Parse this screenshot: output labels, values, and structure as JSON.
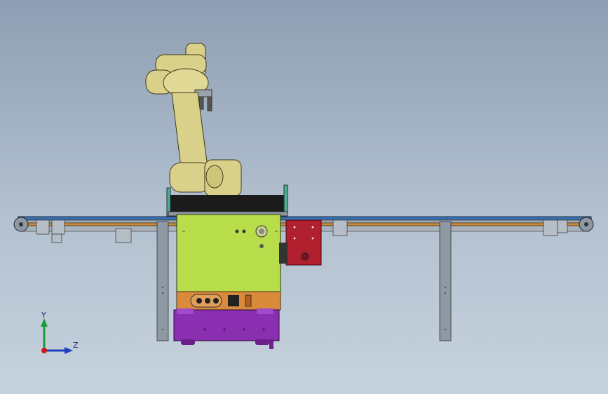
{
  "viewport": {
    "background_top": "#8d9fb3",
    "background_bottom": "#c6d2dd"
  },
  "triad": {
    "y_label": "Y",
    "z_label": "Z",
    "x_axis_color": "#c81a1a",
    "y_axis_color": "#1c9a3a",
    "z_axis_color": "#1f3fbf"
  },
  "model": {
    "robot_arm_color": "#d9d08a",
    "cabinet_color": "#b7dd4a",
    "interface_panel_color": "#d98a3a",
    "base_color": "#8a2fb0",
    "gripper_box_color": "#b0202f",
    "conveyor_belt_color": "#3a6fb0",
    "conveyor_strip_color": "#c98a3a",
    "legs_color": "#8f99a3"
  }
}
